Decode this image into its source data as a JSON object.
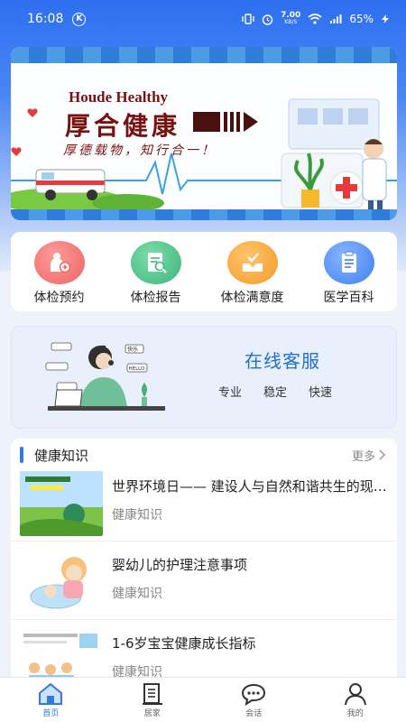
{
  "status_bar": {
    "time": "16:08",
    "k_badge": "K",
    "net_speed_value": "7.00",
    "net_speed_unit": "KB/S",
    "battery": "65%"
  },
  "banner": {
    "brand_en": "Houde Healthy",
    "brand_cn": "厚合健康",
    "slogan": "厚德载物，知行合一！"
  },
  "menu": {
    "items": [
      {
        "label": "体检预约",
        "icon": "appointment-icon",
        "color": "#f07b7b"
      },
      {
        "label": "体检报告",
        "icon": "report-icon",
        "color": "#4cc38a"
      },
      {
        "label": "体检满意度",
        "icon": "satisfaction-icon",
        "color": "#f5a43a"
      },
      {
        "label": "医学百科",
        "icon": "encyclopedia-icon",
        "color": "#4a8ef0"
      }
    ]
  },
  "service": {
    "title": "在线客服",
    "tags": [
      "专业",
      "稳定",
      "快速"
    ],
    "bubbles": [
      "快乐",
      "HELLO"
    ]
  },
  "knowledge": {
    "title": "健康知识",
    "more": "更多",
    "articles": [
      {
        "title": "世界环境日—— 建设人与自然和谐共生的现代化",
        "category": "健康知识"
      },
      {
        "title": "婴幼儿的护理注意事项",
        "category": "健康知识"
      },
      {
        "title": "1-6岁宝宝健康成长指标",
        "category": "健康知识"
      }
    ]
  },
  "tabbar": {
    "tabs": [
      {
        "label": "首页",
        "icon": "home-icon"
      },
      {
        "label": "居家",
        "icon": "document-icon"
      },
      {
        "label": "会话",
        "icon": "chat-icon"
      },
      {
        "label": "我的",
        "icon": "user-icon"
      }
    ]
  },
  "colors": {
    "accent": "#2f7dd8",
    "brand": "#7a1010"
  }
}
